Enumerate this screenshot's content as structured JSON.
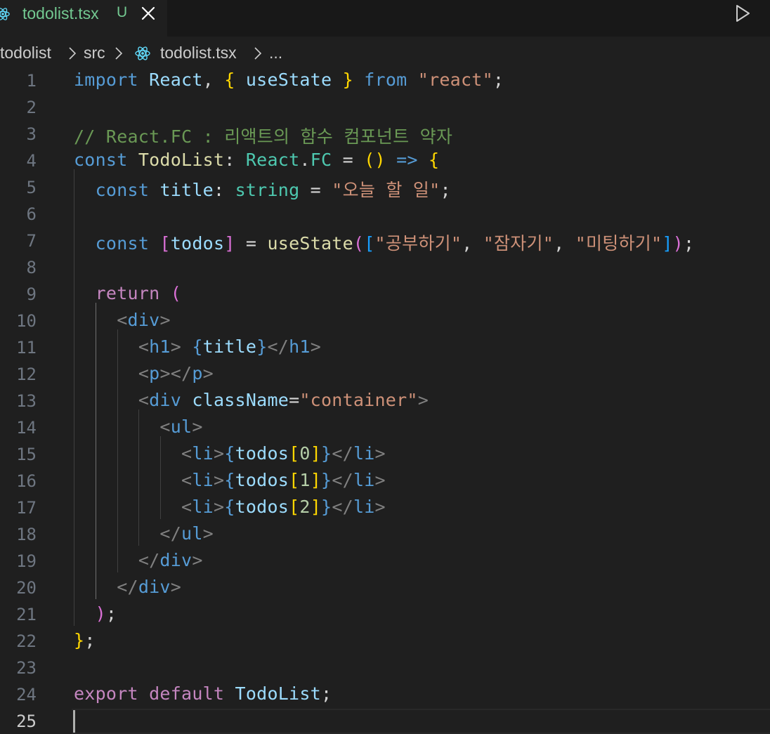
{
  "tab": {
    "filename": "todolist.tsx",
    "status": "U",
    "color": "#73c991"
  },
  "breadcrumb": {
    "items": [
      "todolist",
      "src",
      "todolist.tsx",
      "..."
    ]
  },
  "icons": {
    "file": "react-icon",
    "close": "close-icon",
    "run": "play-icon",
    "separator": "chevron-right-icon"
  },
  "editor": {
    "active_line": 25,
    "lines": [
      {
        "n": "1",
        "tokens": [
          [
            "kw",
            "import"
          ],
          [
            "pun",
            " "
          ],
          [
            "var",
            "React"
          ],
          [
            "pun",
            ", "
          ],
          [
            "b1",
            "{"
          ],
          [
            "pun",
            " "
          ],
          [
            "var",
            "useState"
          ],
          [
            "pun",
            " "
          ],
          [
            "b1",
            "}"
          ],
          [
            "pun",
            " "
          ],
          [
            "kw",
            "from"
          ],
          [
            "pun",
            " "
          ],
          [
            "str",
            "\"react\""
          ],
          [
            "pun",
            ";"
          ]
        ]
      },
      {
        "n": "2",
        "tokens": []
      },
      {
        "n": "3",
        "tokens": [
          [
            "cmt",
            "// React.FC : 리액트의 함수 컴포넌트 약자"
          ]
        ]
      },
      {
        "n": "4",
        "tokens": [
          [
            "kw",
            "const"
          ],
          [
            "pun",
            " "
          ],
          [
            "fn",
            "TodoList"
          ],
          [
            "pun",
            ": "
          ],
          [
            "typ",
            "React"
          ],
          [
            "pun",
            "."
          ],
          [
            "typ",
            "FC"
          ],
          [
            "pun",
            " = "
          ],
          [
            "b1",
            "()"
          ],
          [
            "pun",
            " "
          ],
          [
            "kw",
            "=>"
          ],
          [
            "pun",
            " "
          ],
          [
            "b1",
            "{"
          ]
        ]
      },
      {
        "n": "5",
        "tokens": [
          [
            "pun",
            "  "
          ],
          [
            "kw",
            "const"
          ],
          [
            "pun",
            " "
          ],
          [
            "var",
            "title"
          ],
          [
            "pun",
            ": "
          ],
          [
            "typ",
            "string"
          ],
          [
            "pun",
            " = "
          ],
          [
            "str",
            "\"오늘 할 일\""
          ],
          [
            "pun",
            ";"
          ]
        ]
      },
      {
        "n": "6",
        "tokens": []
      },
      {
        "n": "7",
        "tokens": [
          [
            "pun",
            "  "
          ],
          [
            "kw",
            "const"
          ],
          [
            "pun",
            " "
          ],
          [
            "b2",
            "["
          ],
          [
            "var",
            "todos"
          ],
          [
            "b2",
            "]"
          ],
          [
            "pun",
            " = "
          ],
          [
            "fn",
            "useState"
          ],
          [
            "b2",
            "("
          ],
          [
            "b3",
            "["
          ],
          [
            "str",
            "\"공부하기\""
          ],
          [
            "pun",
            ", "
          ],
          [
            "str",
            "\"잠자기\""
          ],
          [
            "pun",
            ", "
          ],
          [
            "str",
            "\"미팅하기\""
          ],
          [
            "b3",
            "]"
          ],
          [
            "b2",
            ")"
          ],
          [
            "pun",
            ";"
          ]
        ]
      },
      {
        "n": "8",
        "tokens": []
      },
      {
        "n": "9",
        "tokens": [
          [
            "pun",
            "  "
          ],
          [
            "ctl",
            "return"
          ],
          [
            "pun",
            " "
          ],
          [
            "b2",
            "("
          ]
        ]
      },
      {
        "n": "10",
        "tokens": [
          [
            "pun",
            "    "
          ],
          [
            "ang",
            "<"
          ],
          [
            "tag",
            "div"
          ],
          [
            "ang",
            ">"
          ]
        ]
      },
      {
        "n": "11",
        "tokens": [
          [
            "pun",
            "      "
          ],
          [
            "ang",
            "<"
          ],
          [
            "tag",
            "h1"
          ],
          [
            "ang",
            ">"
          ],
          [
            "pun",
            " "
          ],
          [
            "kw",
            "{"
          ],
          [
            "var",
            "title"
          ],
          [
            "kw",
            "}"
          ],
          [
            "ang",
            "</"
          ],
          [
            "tag",
            "h1"
          ],
          [
            "ang",
            ">"
          ]
        ]
      },
      {
        "n": "12",
        "tokens": [
          [
            "pun",
            "      "
          ],
          [
            "ang",
            "<"
          ],
          [
            "tag",
            "p"
          ],
          [
            "ang",
            "></"
          ],
          [
            "tag",
            "p"
          ],
          [
            "ang",
            ">"
          ]
        ]
      },
      {
        "n": "13",
        "tokens": [
          [
            "pun",
            "      "
          ],
          [
            "ang",
            "<"
          ],
          [
            "tag",
            "div"
          ],
          [
            "pun",
            " "
          ],
          [
            "var",
            "className"
          ],
          [
            "pun",
            "="
          ],
          [
            "str",
            "\"container\""
          ],
          [
            "ang",
            ">"
          ]
        ]
      },
      {
        "n": "14",
        "tokens": [
          [
            "pun",
            "        "
          ],
          [
            "ang",
            "<"
          ],
          [
            "tag",
            "ul"
          ],
          [
            "ang",
            ">"
          ]
        ]
      },
      {
        "n": "15",
        "tokens": [
          [
            "pun",
            "          "
          ],
          [
            "ang",
            "<"
          ],
          [
            "tag",
            "li"
          ],
          [
            "ang",
            ">"
          ],
          [
            "kw",
            "{"
          ],
          [
            "var",
            "todos"
          ],
          [
            "b1",
            "["
          ],
          [
            "num",
            "0"
          ],
          [
            "b1",
            "]"
          ],
          [
            "kw",
            "}"
          ],
          [
            "ang",
            "</"
          ],
          [
            "tag",
            "li"
          ],
          [
            "ang",
            ">"
          ]
        ]
      },
      {
        "n": "16",
        "tokens": [
          [
            "pun",
            "          "
          ],
          [
            "ang",
            "<"
          ],
          [
            "tag",
            "li"
          ],
          [
            "ang",
            ">"
          ],
          [
            "kw",
            "{"
          ],
          [
            "var",
            "todos"
          ],
          [
            "b1",
            "["
          ],
          [
            "num",
            "1"
          ],
          [
            "b1",
            "]"
          ],
          [
            "kw",
            "}"
          ],
          [
            "ang",
            "</"
          ],
          [
            "tag",
            "li"
          ],
          [
            "ang",
            ">"
          ]
        ]
      },
      {
        "n": "17",
        "tokens": [
          [
            "pun",
            "          "
          ],
          [
            "ang",
            "<"
          ],
          [
            "tag",
            "li"
          ],
          [
            "ang",
            ">"
          ],
          [
            "kw",
            "{"
          ],
          [
            "var",
            "todos"
          ],
          [
            "b1",
            "["
          ],
          [
            "num",
            "2"
          ],
          [
            "b1",
            "]"
          ],
          [
            "kw",
            "}"
          ],
          [
            "ang",
            "</"
          ],
          [
            "tag",
            "li"
          ],
          [
            "ang",
            ">"
          ]
        ]
      },
      {
        "n": "18",
        "tokens": [
          [
            "pun",
            "        "
          ],
          [
            "ang",
            "</"
          ],
          [
            "tag",
            "ul"
          ],
          [
            "ang",
            ">"
          ]
        ]
      },
      {
        "n": "19",
        "tokens": [
          [
            "pun",
            "      "
          ],
          [
            "ang",
            "</"
          ],
          [
            "tag",
            "div"
          ],
          [
            "ang",
            ">"
          ]
        ]
      },
      {
        "n": "20",
        "tokens": [
          [
            "pun",
            "    "
          ],
          [
            "ang",
            "</"
          ],
          [
            "tag",
            "div"
          ],
          [
            "ang",
            ">"
          ]
        ]
      },
      {
        "n": "21",
        "tokens": [
          [
            "pun",
            "  "
          ],
          [
            "b2",
            ")"
          ],
          [
            "pun",
            ";"
          ]
        ]
      },
      {
        "n": "22",
        "tokens": [
          [
            "b1",
            "}"
          ],
          [
            "pun",
            ";"
          ]
        ]
      },
      {
        "n": "23",
        "tokens": []
      },
      {
        "n": "24",
        "tokens": [
          [
            "ctl",
            "export"
          ],
          [
            "pun",
            " "
          ],
          [
            "ctl",
            "default"
          ],
          [
            "pun",
            " "
          ],
          [
            "var",
            "TodoList"
          ],
          [
            "pun",
            ";"
          ]
        ]
      },
      {
        "n": "25",
        "tokens": []
      }
    ]
  }
}
